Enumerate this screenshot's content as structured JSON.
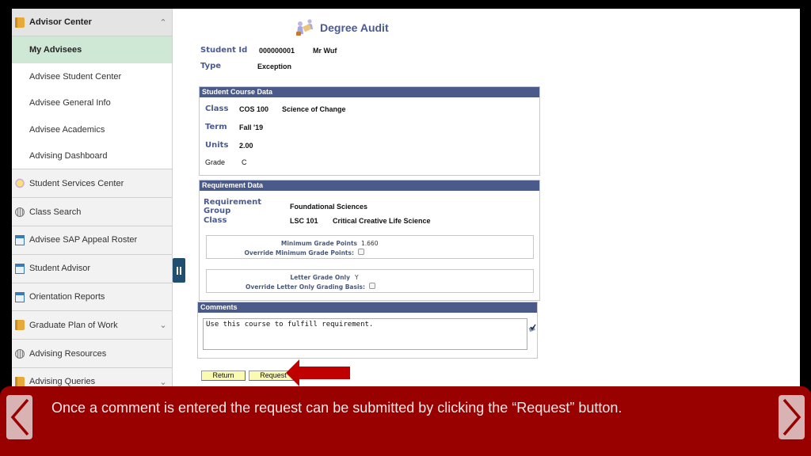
{
  "sidebar": {
    "header": {
      "label": "Advisor Center",
      "icon": "book-icon",
      "expanded": true
    },
    "subitems": [
      {
        "label": "My Advisees",
        "active": true
      },
      {
        "label": "Advisee Student Center"
      },
      {
        "label": "Advisee General Info"
      },
      {
        "label": "Advisee Academics"
      },
      {
        "label": "Advising Dashboard"
      }
    ],
    "items": [
      {
        "label": "Student Services Center",
        "icon": "lightbulb-icon"
      },
      {
        "label": "Class Search",
        "icon": "globe-icon"
      },
      {
        "label": "Advisee SAP Appeal Roster",
        "icon": "window-icon"
      },
      {
        "label": "Student Advisor",
        "icon": "window-icon"
      },
      {
        "label": "Orientation Reports",
        "icon": "window-icon"
      },
      {
        "label": "Graduate Plan of Work",
        "icon": "book-icon",
        "chevron": "down"
      },
      {
        "label": "Advising Resources",
        "icon": "globe-icon"
      },
      {
        "label": "Advising Queries",
        "icon": "book-icon",
        "chevron": "down"
      }
    ]
  },
  "page": {
    "title": "Degree Audit",
    "student_id_label": "Student Id",
    "student_id": "000000001",
    "student_name": "Mr Wuf",
    "type_label": "Type",
    "type": "Exception"
  },
  "student_course": {
    "header": "Student Course Data",
    "class_label": "Class",
    "class_code": "COS 100",
    "class_title": "Science of Change",
    "term_label": "Term",
    "term": "Fall '19",
    "units_label": "Units",
    "units": "2.00",
    "grade_label": "Grade",
    "grade": "C"
  },
  "requirement": {
    "header": "Requirement Data",
    "group_label": "Requirement Group",
    "group": "Foundational Sciences",
    "class_label": "Class",
    "class_code": "LSC 101",
    "class_title": "Critical Creative Life Science",
    "min_grade_label": "Minimum Grade Points",
    "min_grade": "1.660",
    "override_min_label": "Override Minimum Grade Points:",
    "override_min_checked": false,
    "letter_only_label": "Letter Grade Only",
    "letter_only": "Y",
    "override_letter_label": "Override Letter Only Grading Basis:",
    "override_letter_checked": false
  },
  "comments": {
    "header": "Comments",
    "value": "Use this course to fulfill requirement."
  },
  "buttons": {
    "return": "Return",
    "request": "Request"
  },
  "caption": {
    "text": "Once a comment is entered the request can be submitted by clicking the “Request” button.",
    "color": "#990000"
  }
}
